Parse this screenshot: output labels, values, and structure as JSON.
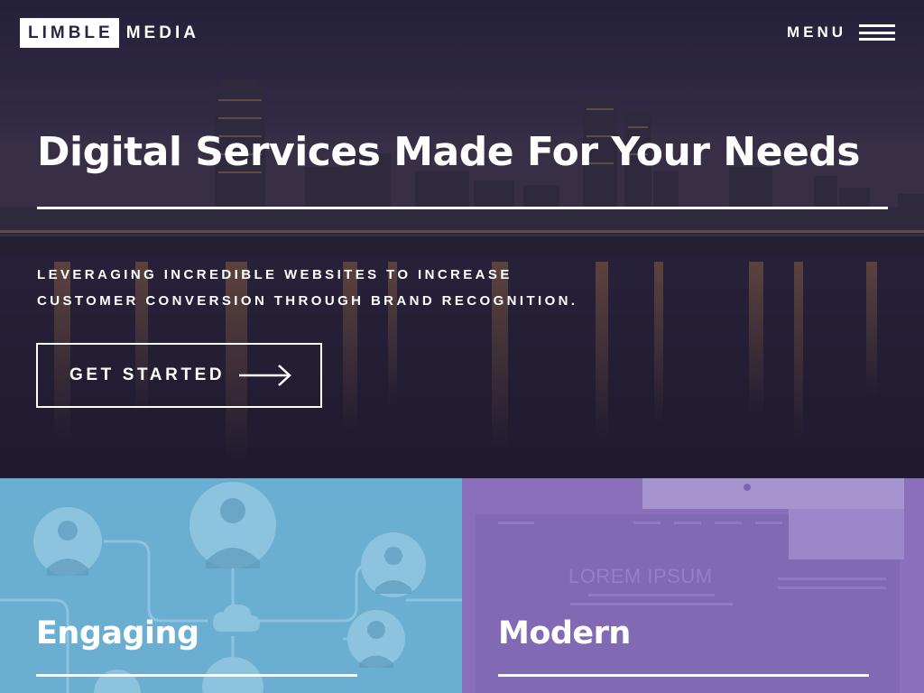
{
  "header": {
    "logo_box": "LIMBLE",
    "logo_rest": "MEDIA",
    "menu_label": "MENU"
  },
  "hero": {
    "title": "Digital Services Made For Your Needs",
    "subtitle_lines": [
      "LEVERAGING INCREDIBLE WEBSITES TO INCREASE",
      "CUSTOMER CONVERSION THROUGH BRAND RECOGNITION."
    ],
    "cta_label": "GET STARTED",
    "cta_icon": "arrow-right-icon"
  },
  "cards": [
    {
      "title": "Engaging",
      "color": "#6aaed1"
    },
    {
      "title": "Modern",
      "color": "#8a6fbb",
      "background_text": "LOREM IPSUM"
    }
  ],
  "colors": {
    "hero_overlay": "#1c1830",
    "text": "#ffffff",
    "card_blue": "#6aaed1",
    "card_purple": "#8a6fbb"
  }
}
